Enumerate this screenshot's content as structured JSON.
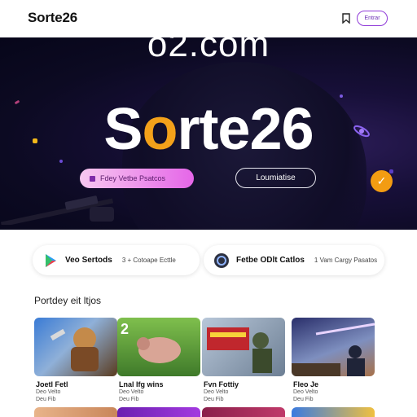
{
  "header": {
    "brand": "Sorte26",
    "button_label": "Entrar"
  },
  "hero": {
    "domain_text": "o2.com",
    "logo_prefix": "S",
    "logo_mark": "o",
    "logo_suffix": "rte26",
    "primary_button": "Fdey Vetbe Psatcos",
    "secondary_button": "Loumiatise",
    "check_glyph": "✓"
  },
  "stores": [
    {
      "name": "Veo Sertods",
      "meta": "3 + Cotoape Ecttle",
      "icon": "play-store-icon"
    },
    {
      "name": "Fetbe ODlt Catlos",
      "meta": "1 Vam Cargy Pasatos",
      "icon": "app-store-icon"
    }
  ],
  "section": {
    "title": "Portdey eit ltjos"
  },
  "games": [
    {
      "title": "Joetl Fetl",
      "sub": "Deo Velto",
      "meta": "Deu Fib"
    },
    {
      "title": "Lnal Ifg wins",
      "sub": "Deo Velto",
      "meta": "Deu Fib"
    },
    {
      "title": "Fvn Fottiy",
      "sub": "Deo Velto",
      "meta": "Deu Fib"
    },
    {
      "title": "Fleo Je",
      "sub": "Deo Velto",
      "meta": "Deu Fib"
    }
  ],
  "colors": {
    "accent_orange": "#f39c12",
    "accent_purple": "#8f3ad8",
    "hero_bg": "#120c30"
  }
}
